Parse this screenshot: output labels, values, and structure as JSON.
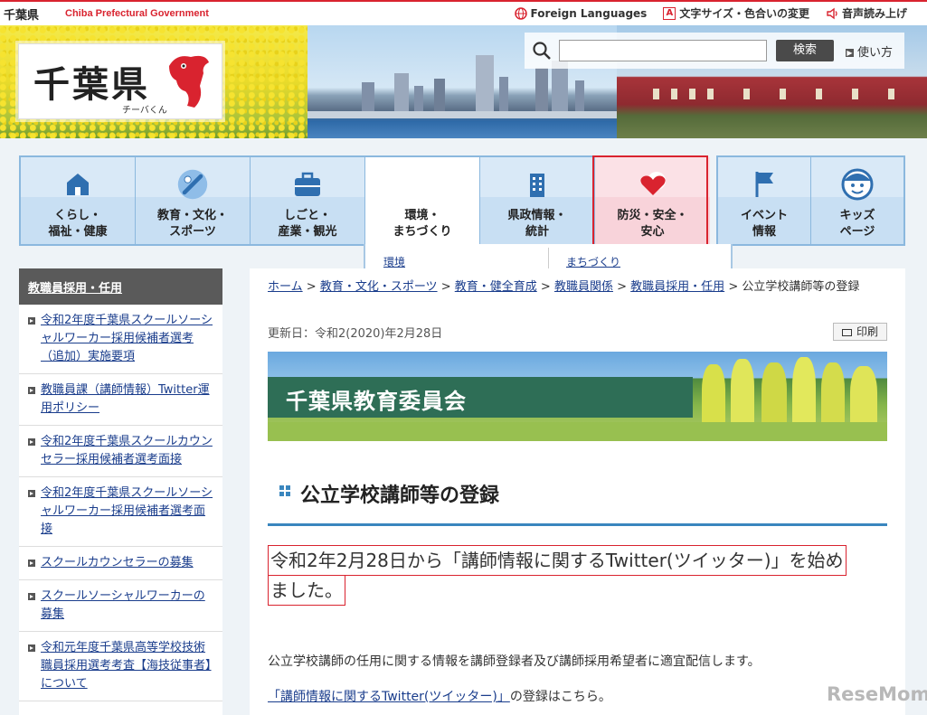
{
  "topbar": {
    "pref_name": "千葉県",
    "pref_name_en": "Chiba Prefectural Government",
    "links": [
      {
        "label": "Foreign Languages",
        "icon": "globe-icon"
      },
      {
        "label": "文字サイズ・色合いの変更",
        "icon": "text-size-icon"
      },
      {
        "label": "音声読み上げ",
        "icon": "speaker-icon"
      }
    ]
  },
  "header": {
    "logo_text": "千葉県",
    "mascot_name": "チーバくん",
    "search": {
      "placeholder": "",
      "value": "",
      "button_label": "検索",
      "howto_label": "使い方"
    }
  },
  "nav": {
    "items": [
      {
        "label": "くらし・\n福祉・健康",
        "icon": "house-icon"
      },
      {
        "label": "教育・文化・\nスポーツ",
        "icon": "baseball-bat-icon"
      },
      {
        "label": "しごと・\n産業・観光",
        "icon": "briefcase-icon"
      },
      {
        "label": "環境・\nまちづくり",
        "icon": ""
      },
      {
        "label": "県政情報・\n統計",
        "icon": "building-icon"
      },
      {
        "label": "防災・安全・\n安心",
        "icon": "heart-icon"
      }
    ],
    "secondary": [
      {
        "label": "イベント\n情報",
        "icon": "flag-icon"
      },
      {
        "label": "キッズ\nページ",
        "icon": "kid-face-icon"
      }
    ],
    "submenu": [
      "環境",
      "まちづくり"
    ]
  },
  "sidebar": {
    "title": "教職員採用・任用",
    "items": [
      "令和2年度千葉県スクールソーシャルワーカー採用候補者選考（追加）実施要項",
      "教職員課（講師情報）Twitter運用ポリシー",
      "令和2年度千葉県スクールカウンセラー採用候補者選考面接",
      "令和2年度千葉県スクールソーシャルワーカー採用候補者選考面接",
      "スクールカウンセラーの募集",
      "スクールソーシャルワーカーの募集",
      "令和元年度千葉県高等学校技術職員採用選考考査【海技従事者】について"
    ]
  },
  "main": {
    "breadcrumb": [
      "ホーム",
      "教育・文化・スポーツ",
      "教育・健全育成",
      "教職員関係",
      "教職員採用・任用"
    ],
    "breadcrumb_current": "公立学校講師等の登録",
    "breadcrumb_sep": ">",
    "updated": "更新日：令和2(2020)年2月28日",
    "print_label": "印刷",
    "banner_text": "千葉県教育委員会",
    "heading": "公立学校講師等の登録",
    "notice_line1": "令和2年2月28日から「講師情報に関するTwitter(ツイッター)」を始め",
    "notice_line2": "ました。",
    "paragraph": "公立学校講師の任用に関する情報を講師登録者及び講師採用希望者に適宜配信します。",
    "register_link": "「講師情報に関するTwitter(ツイッター)」",
    "register_suffix": "の登録はこちら。"
  },
  "watermark": "ReseMom",
  "colors": {
    "accent_red": "#d9232f",
    "nav_blue": "#8bb8de",
    "link": "#1a3d8c",
    "heading_rule": "#3a86be"
  }
}
